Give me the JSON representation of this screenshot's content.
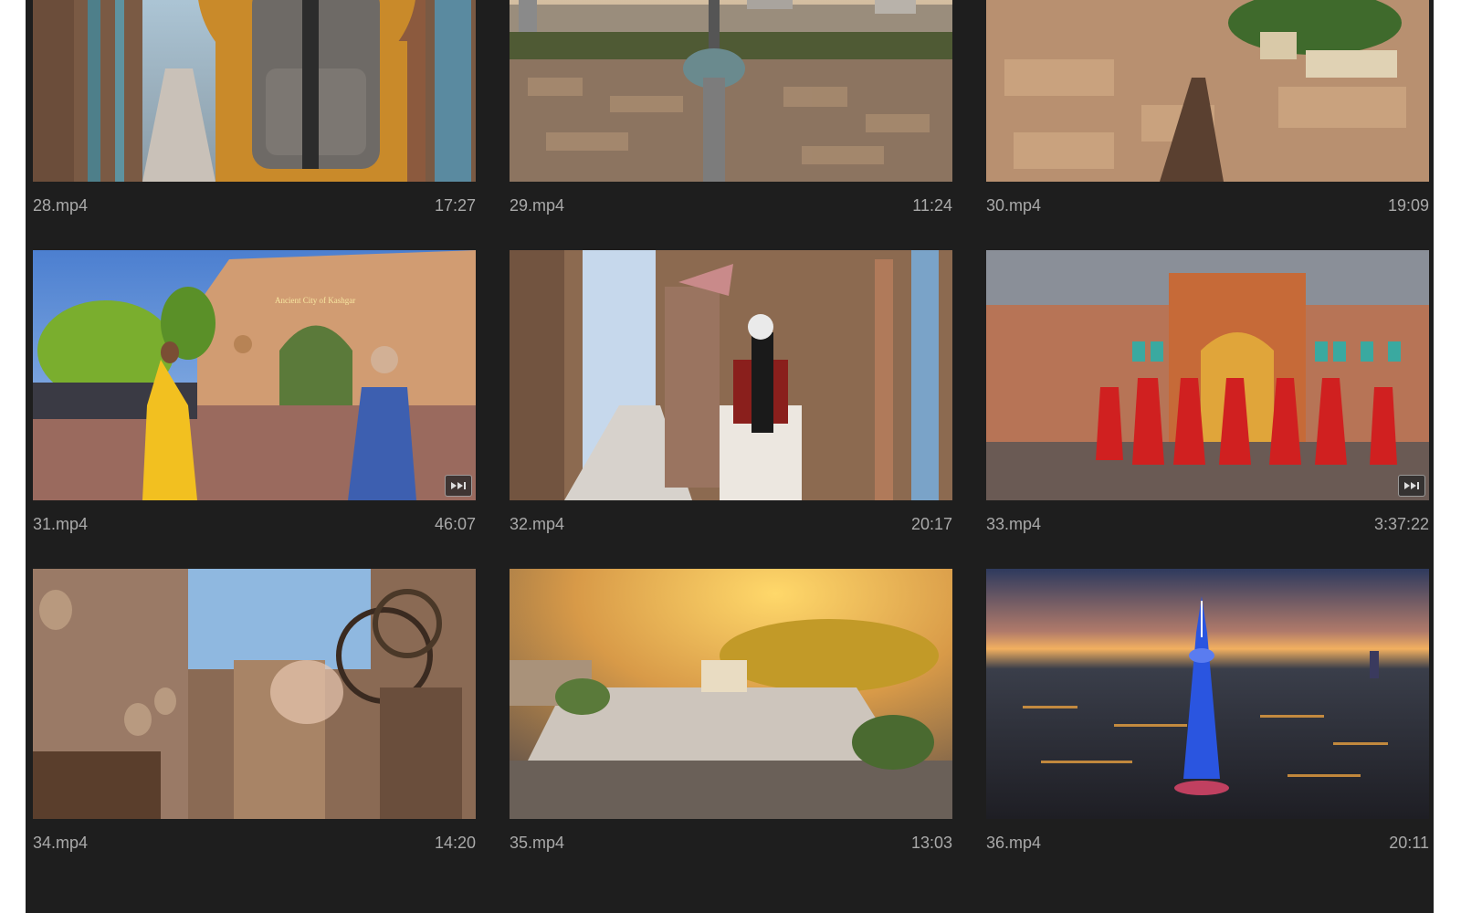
{
  "clips": [
    {
      "name": "28.mp4",
      "duration": "17:27",
      "has_multicam_badge": false,
      "scene": "alley-backpacker"
    },
    {
      "name": "29.mp4",
      "duration": "11:24",
      "has_multicam_badge": false,
      "scene": "city-tower-aerial"
    },
    {
      "name": "30.mp4",
      "duration": "19:09",
      "has_multicam_badge": false,
      "scene": "old-town-aerial"
    },
    {
      "name": "31.mp4",
      "duration": "46:07",
      "has_multicam_badge": true,
      "scene": "city-gate-dancers",
      "gate_sign_text": "Ancient City of Kashgar"
    },
    {
      "name": "32.mp4",
      "duration": "20:17",
      "has_multicam_badge": false,
      "scene": "alley-woman-dress"
    },
    {
      "name": "33.mp4",
      "duration": "3:37:22",
      "has_multicam_badge": true,
      "scene": "palace-performance"
    },
    {
      "name": "34.mp4",
      "duration": "14:20",
      "has_multicam_badge": false,
      "scene": "carved-street-wheels"
    },
    {
      "name": "35.mp4",
      "duration": "13:03",
      "has_multicam_badge": false,
      "scene": "golden-square-aerial"
    },
    {
      "name": "36.mp4",
      "duration": "20:11",
      "has_multicam_badge": false,
      "scene": "night-tower-blue"
    }
  ],
  "colors": {
    "panel_background": "#1e1e1e",
    "label_text": "#a9a9a9"
  }
}
